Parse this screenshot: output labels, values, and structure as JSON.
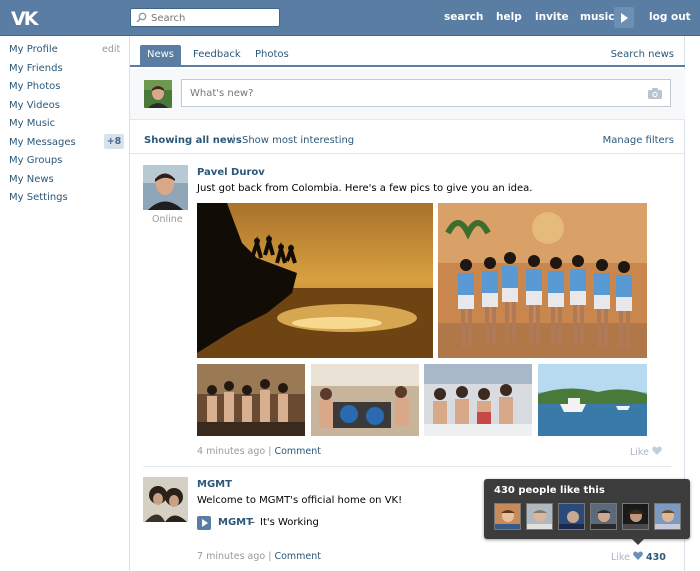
{
  "header": {
    "logo": "VK",
    "search_placeholder": "Search",
    "nav": [
      "search",
      "help",
      "invite",
      "music",
      "log out"
    ]
  },
  "sidebar": {
    "items": [
      "My Profile",
      "My Friends",
      "My Photos",
      "My Videos",
      "My Music",
      "My Messages",
      "My Groups",
      "My News",
      "My Settings"
    ],
    "edit_label": "edit",
    "messages_badge": "+8"
  },
  "tabs": {
    "items": [
      "News",
      "Feedback",
      "Photos"
    ],
    "active": "News",
    "right_link": "Search news"
  },
  "compose": {
    "placeholder": "What's new?"
  },
  "filters": {
    "showing_all": "Showing all news",
    "separator": "|",
    "show_interesting": "Show most interesting",
    "manage": "Manage filters"
  },
  "posts": [
    {
      "author": "Pavel Durov",
      "text": "Just got back from Colombia. Here's a few pics to give you an idea.",
      "status": "Online",
      "time": "4 minutes ago",
      "separator": "|",
      "comment_label": "Comment",
      "like_label": "Like"
    },
    {
      "author": "MGMT",
      "text": "Welcome to MGMT's official home on VK!",
      "audio_artist": "MGMT",
      "audio_dash": "–",
      "audio_title": "It's Working",
      "time": "7 minutes ago",
      "separator": "|",
      "comment_label": "Comment",
      "like_label": "Like",
      "like_count": "430"
    }
  ],
  "tooltip": {
    "title": "430 people like this"
  },
  "colors": {
    "header_blue": "#597da3",
    "link_blue": "#2b587a",
    "tooltip_bg": "#3c3c3c"
  }
}
